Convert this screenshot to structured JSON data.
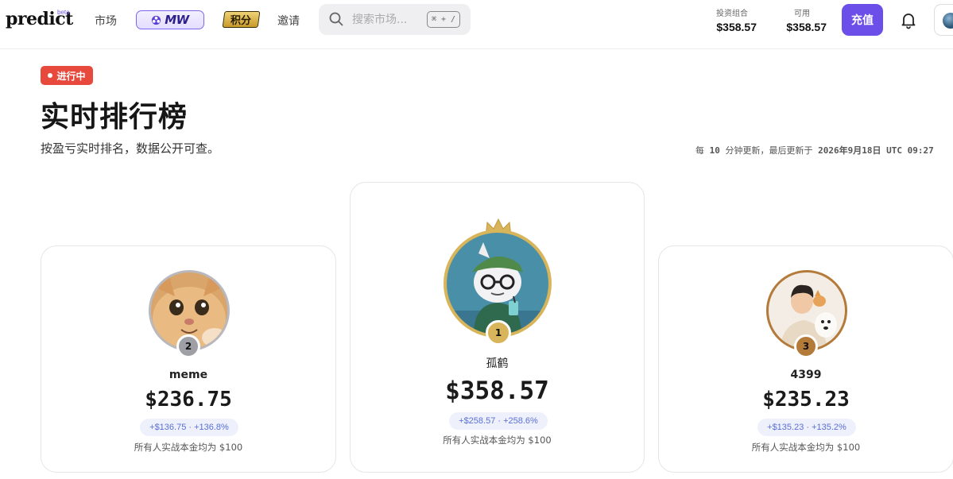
{
  "header": {
    "logo": "predict",
    "logo_tag": "beta",
    "nav": {
      "markets": "市场",
      "mw_badge": "MW",
      "points": "积分",
      "invite": "邀请"
    },
    "search": {
      "placeholder": "搜索市场...",
      "shortcut": "⌘ + /"
    },
    "portfolio": {
      "label": "投资组合",
      "value": "$358.57"
    },
    "available": {
      "label": "可用",
      "value": "$358.57"
    },
    "deposit_label": "充值",
    "icons": [
      "search-icon",
      "bell-icon",
      "avatar-icon"
    ]
  },
  "main": {
    "status_badge": "进行中",
    "title": "实时排行榜",
    "subtitle": "按盈亏实时排名，数据公开可查。",
    "update_info": {
      "prefix": "每",
      "interval": "10",
      "middle": "分钟更新，最后更新于",
      "timestamp": "2026年9月18日 UTC 09:27"
    }
  },
  "leaderboard": [
    {
      "rank": "2",
      "name": "meme",
      "balance": "$236.75",
      "change": "+$136.75 · +136.8%",
      "note": "所有人实战本金均为 $100",
      "ring_color": "#b8b8bd",
      "badge_color": "#9ea0a6"
    },
    {
      "rank": "1",
      "name": "孤鹤",
      "balance": "$358.57",
      "change": "+$258.57 · +258.6%",
      "note": "所有人实战本金均为 $100",
      "ring_color": "#d8b45a",
      "badge_color": "#d8b45a"
    },
    {
      "rank": "3",
      "name": "4399",
      "balance": "$235.23",
      "change": "+$135.23 · +135.2%",
      "note": "所有人实战本金均为 $100",
      "ring_color": "#b37a3a",
      "badge_color": "#b37a3a"
    }
  ]
}
